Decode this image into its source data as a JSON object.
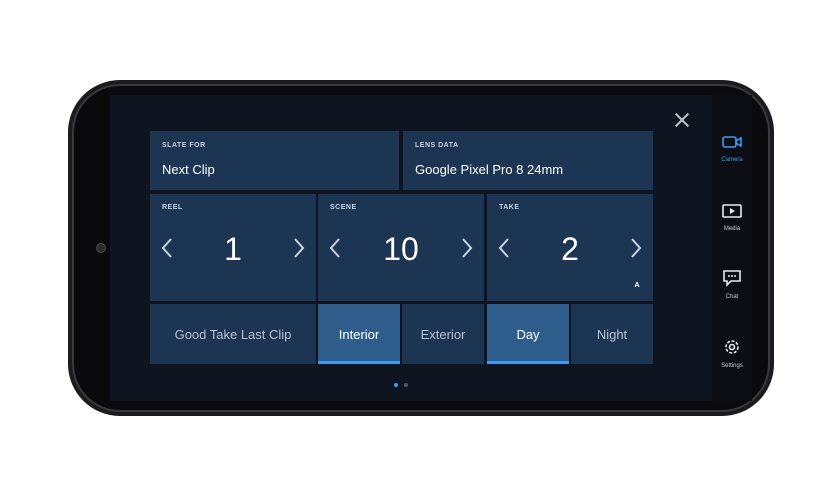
{
  "slate_for": {
    "label": "SLATE FOR",
    "value": "Next Clip"
  },
  "lens_data": {
    "label": "LENS DATA",
    "value": "Google Pixel Pro 8 24mm"
  },
  "reel": {
    "label": "REEL",
    "value": "1"
  },
  "scene": {
    "label": "SCENE",
    "value": "10"
  },
  "take": {
    "label": "TAKE",
    "value": "2",
    "suffix": "A"
  },
  "good_take": {
    "label": "Good Take Last Clip"
  },
  "location": {
    "interior": "Interior",
    "exterior": "Exterior",
    "selected": "Interior"
  },
  "time_of_day": {
    "day": "Day",
    "night": "Night",
    "selected": "Day"
  },
  "pager": {
    "current": 1,
    "total": 2
  },
  "sidebar": {
    "items": [
      {
        "label": "Camera",
        "icon": "camera-icon",
        "active": true
      },
      {
        "label": "Media",
        "icon": "media-icon",
        "active": false
      },
      {
        "label": "Chat",
        "icon": "chat-icon",
        "active": false
      },
      {
        "label": "Settings",
        "icon": "settings-icon",
        "active": false
      }
    ]
  },
  "colors": {
    "tile": "#1b3552",
    "active": "#2f5d8b",
    "accent": "#3d9cf0",
    "background": "#0f1520"
  }
}
